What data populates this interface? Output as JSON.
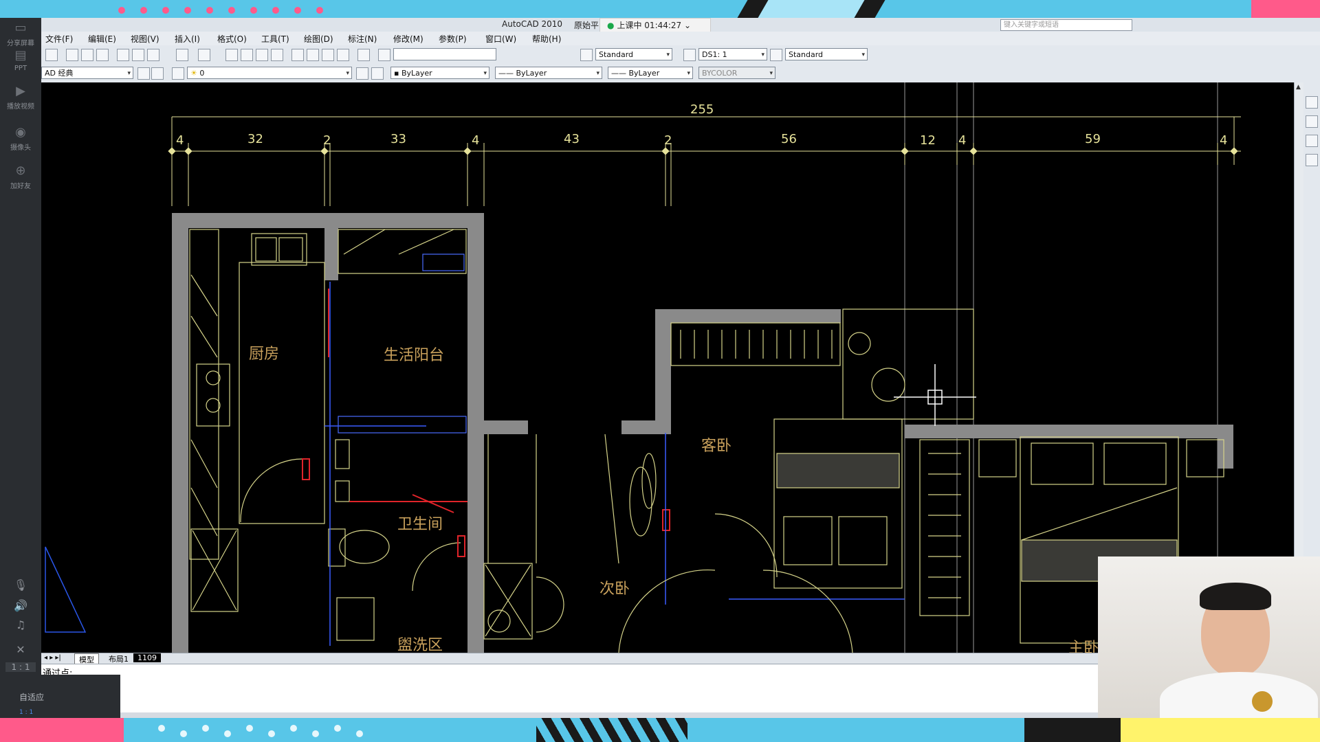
{
  "sidebar": {
    "items": [
      {
        "label": "分享屏幕",
        "icon": "share-screen-icon"
      },
      {
        "label": "PPT",
        "icon": "ppt-icon"
      },
      {
        "label": "播放视频",
        "icon": "play-video-icon"
      },
      {
        "label": "摄像头",
        "icon": "camera-icon"
      },
      {
        "label": "加好友",
        "icon": "add-friend-icon"
      }
    ],
    "zoom_label": "1 : 1",
    "adaptive_label": "自适应",
    "adaptive_sub": "1 : 1"
  },
  "titlebar": {
    "app_title": "AutoCAD 2010",
    "file_name": "原始平",
    "live_status": "上课中 01:44:27",
    "search_placeholder": "键入关键字或短语"
  },
  "menu": [
    "文件(F)",
    "编辑(E)",
    "视图(V)",
    "插入(I)",
    "格式(O)",
    "工具(T)",
    "绘图(D)",
    "标注(N)",
    "修改(M)",
    "参数(P)",
    "窗口(W)",
    "帮助(H)"
  ],
  "toolbar": {
    "text_style": "Standard",
    "dim_style": "DS1: 1",
    "table_style": "Standard",
    "workspace": "AD 经典",
    "layer": "0",
    "color": "ByLayer",
    "linetype": "ByLayer",
    "lineweight": "ByLayer",
    "plotstyle": "BYCOLOR"
  },
  "drawing": {
    "total_dimension": "255",
    "dimensions": [
      "4",
      "32",
      "2",
      "33",
      "4",
      "43",
      "2",
      "56",
      "12",
      "4",
      "59",
      "4"
    ],
    "rooms": {
      "kitchen": "厨房",
      "balcony": "生活阳台",
      "bathroom": "卫生间",
      "guest_bedroom": "客卧",
      "second_bedroom": "次卧",
      "wash_area": "盥洗区",
      "master_bedroom": "主卧"
    }
  },
  "layout_tabs": [
    "模型",
    "布局1",
    "1109"
  ],
  "command_prompt": "通过点:",
  "colors": {
    "wall": "#8a8a8a",
    "dimension": "#e6e29a",
    "room_label": "#c9a15c",
    "accent_red": "#e0242a"
  }
}
